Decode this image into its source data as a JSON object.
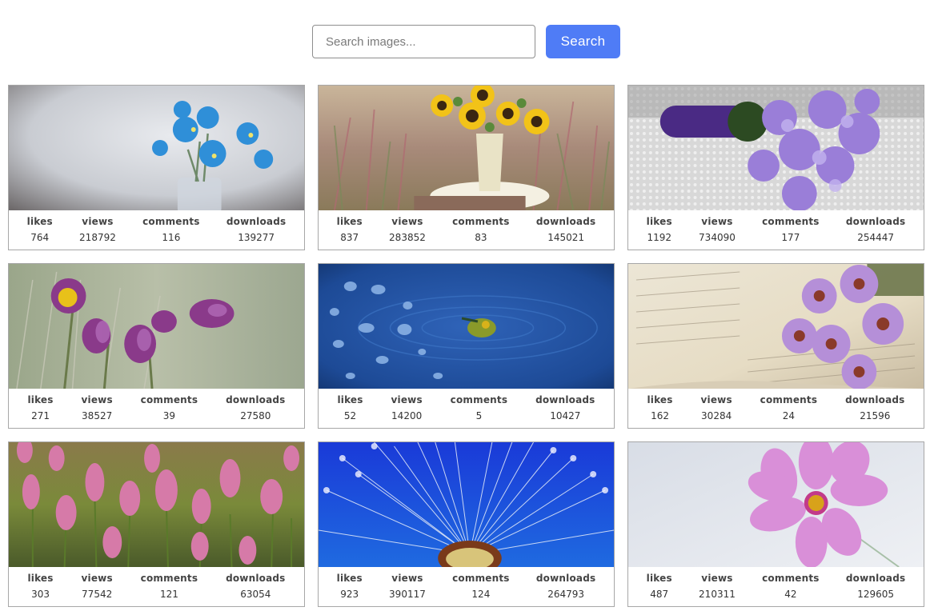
{
  "search": {
    "placeholder": "Search images...",
    "button_label": "Search"
  },
  "stat_labels": {
    "likes": "likes",
    "views": "views",
    "comments": "comments",
    "downloads": "downloads"
  },
  "cards": [
    {
      "image": "blue-flowers-in-vase",
      "likes": "764",
      "views": "218792",
      "comments": "116",
      "downloads": "139277"
    },
    {
      "image": "sunflowers-in-vase",
      "likes": "837",
      "views": "283852",
      "comments": "83",
      "downloads": "145021"
    },
    {
      "image": "purple-bouquet",
      "likes": "1192",
      "views": "734090",
      "comments": "177",
      "downloads": "254447"
    },
    {
      "image": "pasque-flowers",
      "likes": "271",
      "views": "38527",
      "comments": "39",
      "downloads": "27580"
    },
    {
      "image": "flower-on-water",
      "likes": "52",
      "views": "14200",
      "comments": "5",
      "downloads": "10427"
    },
    {
      "image": "asters-on-book",
      "likes": "162",
      "views": "30284",
      "comments": "24",
      "downloads": "21596"
    },
    {
      "image": "pink-bistort-field",
      "likes": "303",
      "views": "77542",
      "comments": "121",
      "downloads": "63054"
    },
    {
      "image": "dandelion-seed-head",
      "likes": "923",
      "views": "390117",
      "comments": "124",
      "downloads": "264793"
    },
    {
      "image": "pink-cosmos-flower",
      "likes": "487",
      "views": "210311",
      "comments": "42",
      "downloads": "129605"
    }
  ]
}
